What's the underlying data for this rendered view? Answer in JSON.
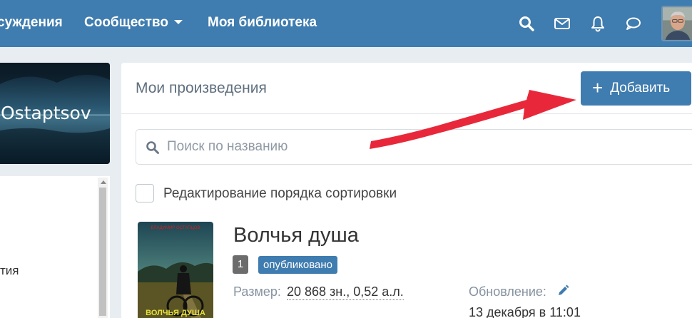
{
  "nav": {
    "discussions": "суждения",
    "community": "Сообщество",
    "library": "Моя библиотека",
    "icons": [
      "search-icon",
      "mail-icon",
      "bell-icon",
      "chat-icon"
    ]
  },
  "profile": {
    "banner_name": "Ostaptsov",
    "left_item": "тия"
  },
  "works": {
    "title": "Мои произведения",
    "add_button": "Добавить",
    "search_placeholder": "Поиск по названию",
    "sort_label": "Редактирование порядка сортировки",
    "item": {
      "title": "Волчья душа",
      "number": "1",
      "status": "опубликовано",
      "size_label": "Размер:",
      "size_value": "20 868 зн., 0,52 а.л.",
      "updated_label": "Обновление:",
      "updated_date": "13 декабря в 11:01",
      "cover_title": "ВОЛЧЬЯ ДУША",
      "cover_author": "ВЛАДИМИР ОСТАПЦОВ"
    }
  },
  "colors": {
    "brand": "#3f7caf",
    "annotation_arrow": "#e8283a"
  }
}
